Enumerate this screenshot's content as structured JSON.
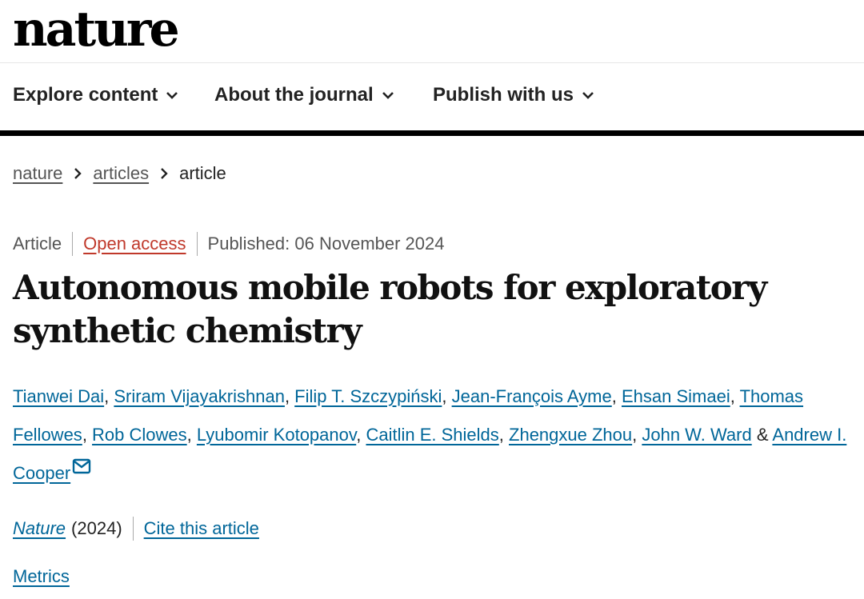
{
  "header": {
    "logo": "nature"
  },
  "nav": {
    "items": [
      {
        "label": "Explore content",
        "icon": "chevron-down-icon"
      },
      {
        "label": "About the journal",
        "icon": "chevron-down-icon"
      },
      {
        "label": "Publish with us",
        "icon": "chevron-down-icon"
      }
    ]
  },
  "breadcrumb": {
    "items": [
      {
        "label": "nature",
        "link": true
      },
      {
        "label": "articles",
        "link": true
      },
      {
        "label": "article",
        "link": false
      }
    ],
    "separator_icon": "chevron-right-icon"
  },
  "article": {
    "type": "Article",
    "access": "Open access",
    "published": "Published: 06 November 2024",
    "title_line1": "Autonomous mobile robots for exploratory",
    "title_line2": "synthetic chemistry",
    "authors": [
      "Tianwei Dai",
      "Sriram Vijayakrishnan",
      "Filip T. Szczypiński",
      "Jean-François Ayme",
      "Ehsan Simaei",
      "Thomas Fellowes",
      "Rob Clowes",
      "Lyubomir Kotopanov",
      "Caitlin E. Shields",
      "Zhengxue Zhou",
      "John W. Ward",
      "Andrew I. Cooper"
    ],
    "author_separator": ", ",
    "author_conjunction": " & ",
    "corresponding_icon": "mail-icon",
    "journal": "Nature",
    "year": "(2024)",
    "cite_label": "Cite this article",
    "metrics_label": "Metrics"
  },
  "colors": {
    "link": "#006699",
    "open_access": "#c0392b",
    "text": "#222222"
  }
}
